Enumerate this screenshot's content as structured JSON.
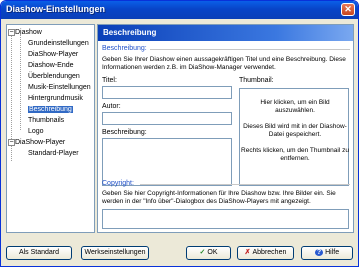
{
  "window": {
    "title": "Diashow-Einstellungen",
    "close_glyph": "✕"
  },
  "tree": {
    "items": [
      {
        "label": "Diashow",
        "expander": "−"
      },
      {
        "label": "Grundeinstellungen"
      },
      {
        "label": "DiaShow-Player"
      },
      {
        "label": "Diashow-Ende"
      },
      {
        "label": "Überblendungen"
      },
      {
        "label": "Musik-Einstellungen"
      },
      {
        "label": "Hintergrundmusik"
      },
      {
        "label": "Beschreibung"
      },
      {
        "label": "Thumbnails"
      },
      {
        "label": "Logo"
      },
      {
        "label": "DiaShow-Player",
        "expander": "−"
      },
      {
        "label": "Standard-Player"
      }
    ],
    "selected_label": "Beschreibung"
  },
  "panel": {
    "header": "Beschreibung",
    "description_group": "Beschreibung:",
    "description_text": "Geben Sie Ihrer Diashow einen aussagekräftigen Titel und eine Beschreibung. Diese Informationen werden z.B. im DiaShow-Manager verwendet.",
    "title_label": "Titel:",
    "title_value": "",
    "author_label": "Autor:",
    "author_value": "",
    "beschreibung_label": "Beschreibung:",
    "beschreibung_value": "",
    "thumbnail_label": "Thumbnail:",
    "thumbnail_text_1": "Hier klicken, um ein Bild auszuwählen.",
    "thumbnail_text_2": "Dieses Bild wird mit in der Diashow-Datei gespeichert.",
    "thumbnail_text_3": "Rechts klicken, um den Thumbnail zu entfernen.",
    "copyright_group": "Copyright:",
    "copyright_text": "Geben Sie hier Copyright-Informationen für Ihre Diashow bzw. Ihre Bilder ein. Sie werden in der \"Info über\"-Dialogbox des DiaShow-Players mit angezeigt.",
    "copyright_value": ""
  },
  "buttons": {
    "default": "Als Standard",
    "factory": "Werkseinstellungen",
    "ok": "OK",
    "cancel": "Abbrechen",
    "help": "Hilfe",
    "ok_icon": "✓",
    "cancel_icon": "✗",
    "help_icon": "?"
  },
  "colors": {
    "accent": "#0a3fb8",
    "selection": "#316ac5",
    "group_label": "#2050c8"
  }
}
